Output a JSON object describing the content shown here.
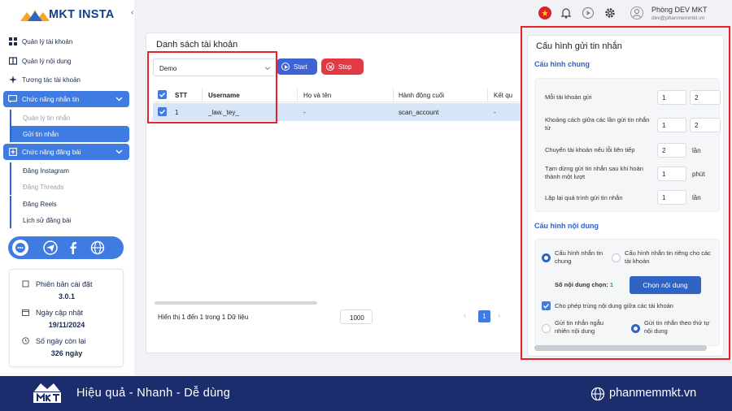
{
  "app": {
    "logo_text": "MKT INSTA"
  },
  "sidebar": {
    "items": [
      {
        "label": "Quản lý tài khoản",
        "icon": "grid-icon"
      },
      {
        "label": "Quản lý nội dung",
        "icon": "book-icon"
      },
      {
        "label": "Tương tác tài khoản",
        "icon": "sparkle-icon"
      }
    ],
    "messaging": {
      "label": "Chức năng nhắn tin",
      "icon": "message-icon",
      "subitems": [
        "Quản lý tin nhắn",
        "Gửi tin nhắn"
      ]
    },
    "posting": {
      "label": "Chức năng đăng bài",
      "icon": "post-icon",
      "subitems": [
        "Đăng Instagram",
        "Đăng Threads",
        "Đăng Reels",
        "Lịch sử đăng bài"
      ]
    },
    "info": {
      "version_label": "Phiên bản cài đặt",
      "version_value": "3.0.1",
      "updated_label": "Ngày cập nhật",
      "updated_value": "19/11/2024",
      "days_label": "Số ngày còn lại",
      "days_value": "326 ngày"
    }
  },
  "header": {
    "account_name": "Phòng DEV MKT",
    "account_email": "dev@phanmemmkt.vn"
  },
  "accounts": {
    "title": "Danh sách tài khoản",
    "select_value": "Demo",
    "start_label": "Start",
    "stop_label": "Stop",
    "columns": [
      "STT",
      "Username",
      "Họ và tên",
      "Hành động cuối",
      "Kết qu"
    ],
    "rows": [
      {
        "stt": "1",
        "username": "_law._tey_",
        "fullname": "-",
        "last_action": "scan_account",
        "result": "-"
      }
    ],
    "footer_info": "Hiển thị 1 đến 1 trong 1 Dữ liệu",
    "page_size": "1000",
    "current_page": "1"
  },
  "config": {
    "title": "Cấu hình gửi tin nhắn",
    "general_title": "Cấu hình chung",
    "per_account_label": "Mỗi tài khoản gửi",
    "per_account_min": "1",
    "per_account_max": "2",
    "interval_label": "Khoảng cách giữa các lần gửi tin nhắn từ",
    "interval_min": "1",
    "interval_max": "2",
    "switch_label": "Chuyển tài khoản nếu lỗi liên tiếp",
    "switch_value": "2",
    "switch_unit": "lần",
    "pause_label": "Tạm dừng gửi tin nhắn sau khi hoàn thành một lượt",
    "pause_value": "1",
    "pause_unit": "phút",
    "repeat_label": "Lặp lại quá trình gửi tin nhắn",
    "repeat_value": "1",
    "repeat_unit": "lần",
    "content_title": "Cấu hình nội dung",
    "mode_common": "Cấu hình nhắn tin chung",
    "mode_separate": "Cấu hình nhắn tin riêng cho các tài khoản",
    "selected_label": "Số nội dung chọn:",
    "selected_count": "1",
    "pick_button": "Chọn nội dung",
    "allow_duplicate": "Cho phép trùng nội dung giữa các tài khoản",
    "random_order": "Gửi tin nhắn ngẫu nhiên nội dung",
    "sequential_order": "Gửi tin nhắn theo thứ tự nội dung"
  },
  "banner": {
    "tagline": "Hiệu quả - Nhanh - Dễ dùng",
    "website": "phanmemmkt.vn"
  },
  "colors": {
    "primary": "#3f7be0",
    "start": "#3f63d4",
    "stop": "#e23a45",
    "highlight": "#e8222c",
    "banner": "#1b2d6d"
  }
}
